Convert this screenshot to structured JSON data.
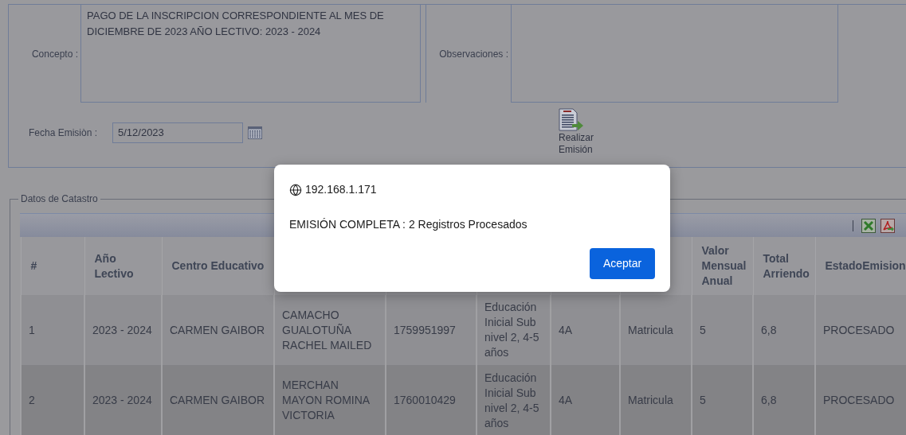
{
  "form": {
    "concepto": {
      "label": "Concepto :",
      "value": "PAGO DE LA INSCRIPCION CORRESPONDIENTE AL MES DE DICIEMBRE DE 2023 AÑO LECTIVO: 2023 - 2024"
    },
    "observaciones": {
      "label": "Observaciones :"
    },
    "fecha": {
      "label": "Fecha Emisiòn :",
      "value": "5/12/2023"
    },
    "action": {
      "label": "Realizar Emisión"
    }
  },
  "catastro": {
    "legend": "Datos de Catastro",
    "columns_left": [
      "#",
      "Año Lectivo",
      "Centro Educativo"
    ],
    "columns_right": [
      "Valor Mensual Anual",
      "Total Arriendo",
      "EstadoEmision"
    ],
    "rows": [
      {
        "cells": [
          "1",
          "2023 - 2024",
          "CARMEN GAIBOR",
          "CAMACHO GUALOTUÑA RACHEL MAILED",
          "1759951997",
          "Educación Inicial Sub nivel 2, 4-5 años",
          "4A",
          "Matricula",
          "5",
          "6,8",
          "PROCESADO"
        ]
      },
      {
        "cells": [
          "2",
          "2023 - 2024",
          "CARMEN GAIBOR",
          "MERCHAN MAYON ROMINA VICTORIA",
          "1760010429",
          "Educación Inicial Sub nivel 2, 4-5 años",
          "4A",
          "Matricula",
          "5",
          "6,8",
          "PROCESADO"
        ]
      }
    ]
  },
  "dialog": {
    "origin": "192.168.1.171",
    "message": "EMISIÓN COMPLETA : 2 Registros Procesados",
    "button": "Aceptar"
  }
}
